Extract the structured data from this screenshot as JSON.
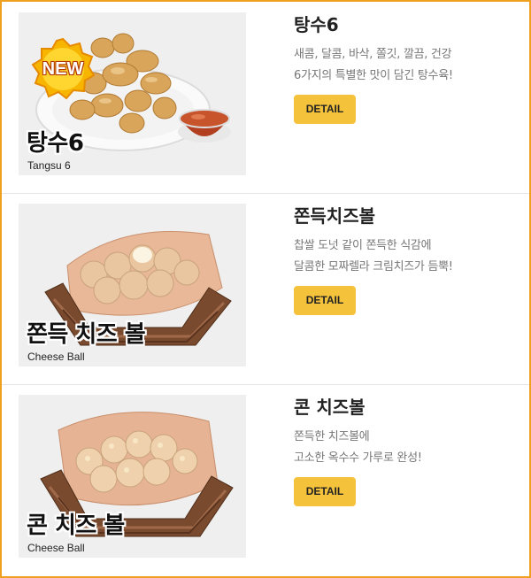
{
  "menu": {
    "items": [
      {
        "title": "탕수6",
        "desc_lines": [
          "새콤, 달콤, 바삭, 쫄깃, 깔끔, 건강",
          "6가지의 특별한 맛이 담긴 탕수육!"
        ],
        "detail_label": "DETAIL",
        "photo_label_kr": "탕수6",
        "photo_label_en": "Tangsu 6",
        "badge": "NEW"
      },
      {
        "title": "쫀득치즈볼",
        "desc_lines": [
          "찹쌀 도넛 같이 쫀득한 식감에",
          "달콤한 모짜렐라 크림치즈가 듬뿍!"
        ],
        "detail_label": "DETAIL",
        "photo_label_kr": "쫀득 치즈 볼",
        "photo_label_en": "Cheese Ball"
      },
      {
        "title": "콘 치즈볼",
        "desc_lines": [
          "쫀득한 치즈볼에",
          "고소한 옥수수 가루로 완성!"
        ],
        "detail_label": "DETAIL",
        "photo_label_kr": "콘 치즈 볼",
        "photo_label_en": "Cheese Ball"
      }
    ]
  },
  "colors": {
    "frame_border": "#f0a020",
    "detail_button": "#f5c33b",
    "divider": "#e6e6e6"
  }
}
